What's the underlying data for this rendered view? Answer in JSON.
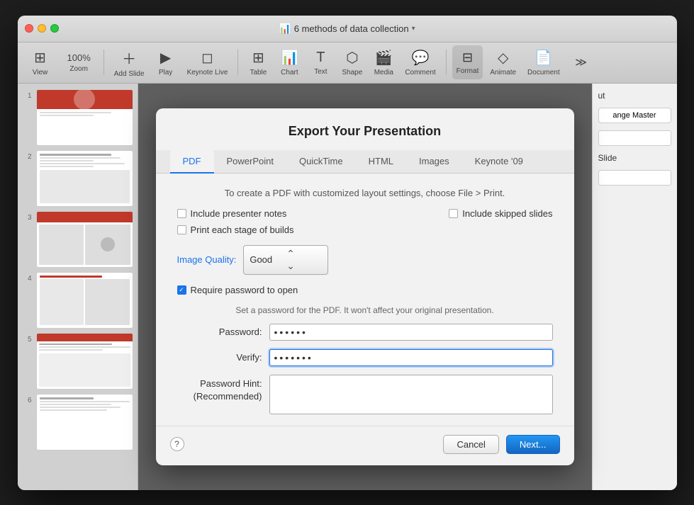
{
  "window": {
    "title": "6 methods of data collection",
    "traffic_lights": [
      "close",
      "minimize",
      "maximize"
    ]
  },
  "toolbar": {
    "view_label": "View",
    "zoom_label": "Zoom",
    "zoom_value": "100%",
    "add_slide_label": "Add Slide",
    "play_label": "Play",
    "keynote_live_label": "Keynote Live",
    "table_label": "Table",
    "chart_label": "Chart",
    "text_label": "Text",
    "shape_label": "Shape",
    "media_label": "Media",
    "comment_label": "Comment",
    "format_label": "Format",
    "animate_label": "Animate",
    "document_label": "Document"
  },
  "slides": [
    {
      "num": "1",
      "type": "title-slide"
    },
    {
      "num": "2",
      "type": "content-slide"
    },
    {
      "num": "3",
      "type": "content-slide"
    },
    {
      "num": "4",
      "type": "content-slide"
    },
    {
      "num": "5",
      "type": "content-slide"
    },
    {
      "num": "6",
      "type": "content-slide"
    }
  ],
  "right_panel": {
    "tab_label": "ut",
    "change_master_btn": "ange Master",
    "slide_label": "Slide"
  },
  "modal": {
    "title": "Export Your Presentation",
    "tabs": [
      "PDF",
      "PowerPoint",
      "QuickTime",
      "HTML",
      "Images",
      "Keynote '09"
    ],
    "active_tab": "PDF",
    "info_text": "To create a PDF with customized layout settings, choose File > Print.",
    "checkbox_include_notes": {
      "label": "Include presenter notes",
      "checked": false
    },
    "checkbox_skipped": {
      "label": "Include skipped slides",
      "checked": false
    },
    "checkbox_builds": {
      "label": "Print each stage of builds",
      "checked": false
    },
    "image_quality_label": "Image Quality:",
    "image_quality_value": "Good",
    "require_password": {
      "label": "Require password to open",
      "checked": true
    },
    "password_hint_text": "Set a password for the PDF. It won't affect your original presentation.",
    "password_label": "Password:",
    "password_value": "●●●●●●",
    "verify_label": "Verify:",
    "verify_value": "●●●●●●●",
    "hint_label": "Password Hint:\n(Recommended)",
    "hint_placeholder": "",
    "cancel_btn": "Cancel",
    "next_btn": "Next...",
    "help_icon": "?"
  }
}
